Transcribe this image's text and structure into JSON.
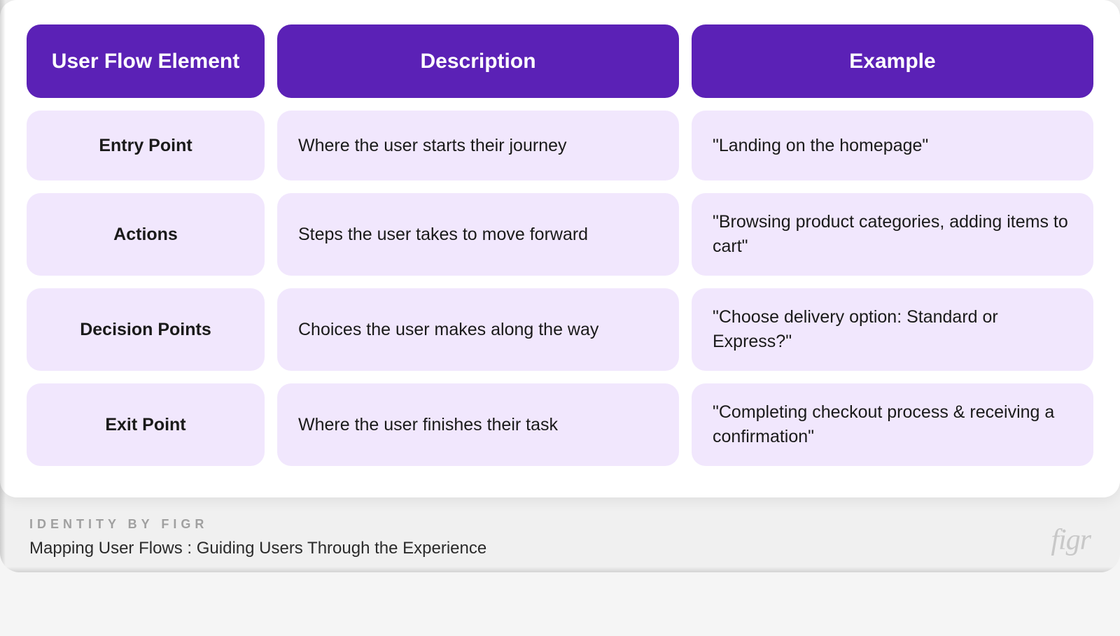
{
  "table": {
    "headers": {
      "col1": "User Flow Element",
      "col2": "Description",
      "col3": "Example"
    },
    "rows": [
      {
        "element": "Entry Point",
        "description": "Where the user starts their journey",
        "example": "\"Landing on the homepage\""
      },
      {
        "element": "Actions",
        "description": "Steps the user takes to move forward",
        "example": "\"Browsing product categories, adding items to cart\""
      },
      {
        "element": "Decision Points",
        "description": "Choices the user makes along the way",
        "example": "\"Choose delivery option: Standard or Express?\""
      },
      {
        "element": "Exit Point",
        "description": "Where the user finishes their task",
        "example": "\"Completing checkout process & receiving a confirmation\""
      }
    ]
  },
  "footer": {
    "kicker": "IDENTITY BY FIGR",
    "title": "Mapping User Flows : Guiding Users Through the Experience",
    "logo": "figr"
  },
  "colors": {
    "header_bg": "#5b21b6",
    "cell_bg": "#f1e7fd"
  }
}
